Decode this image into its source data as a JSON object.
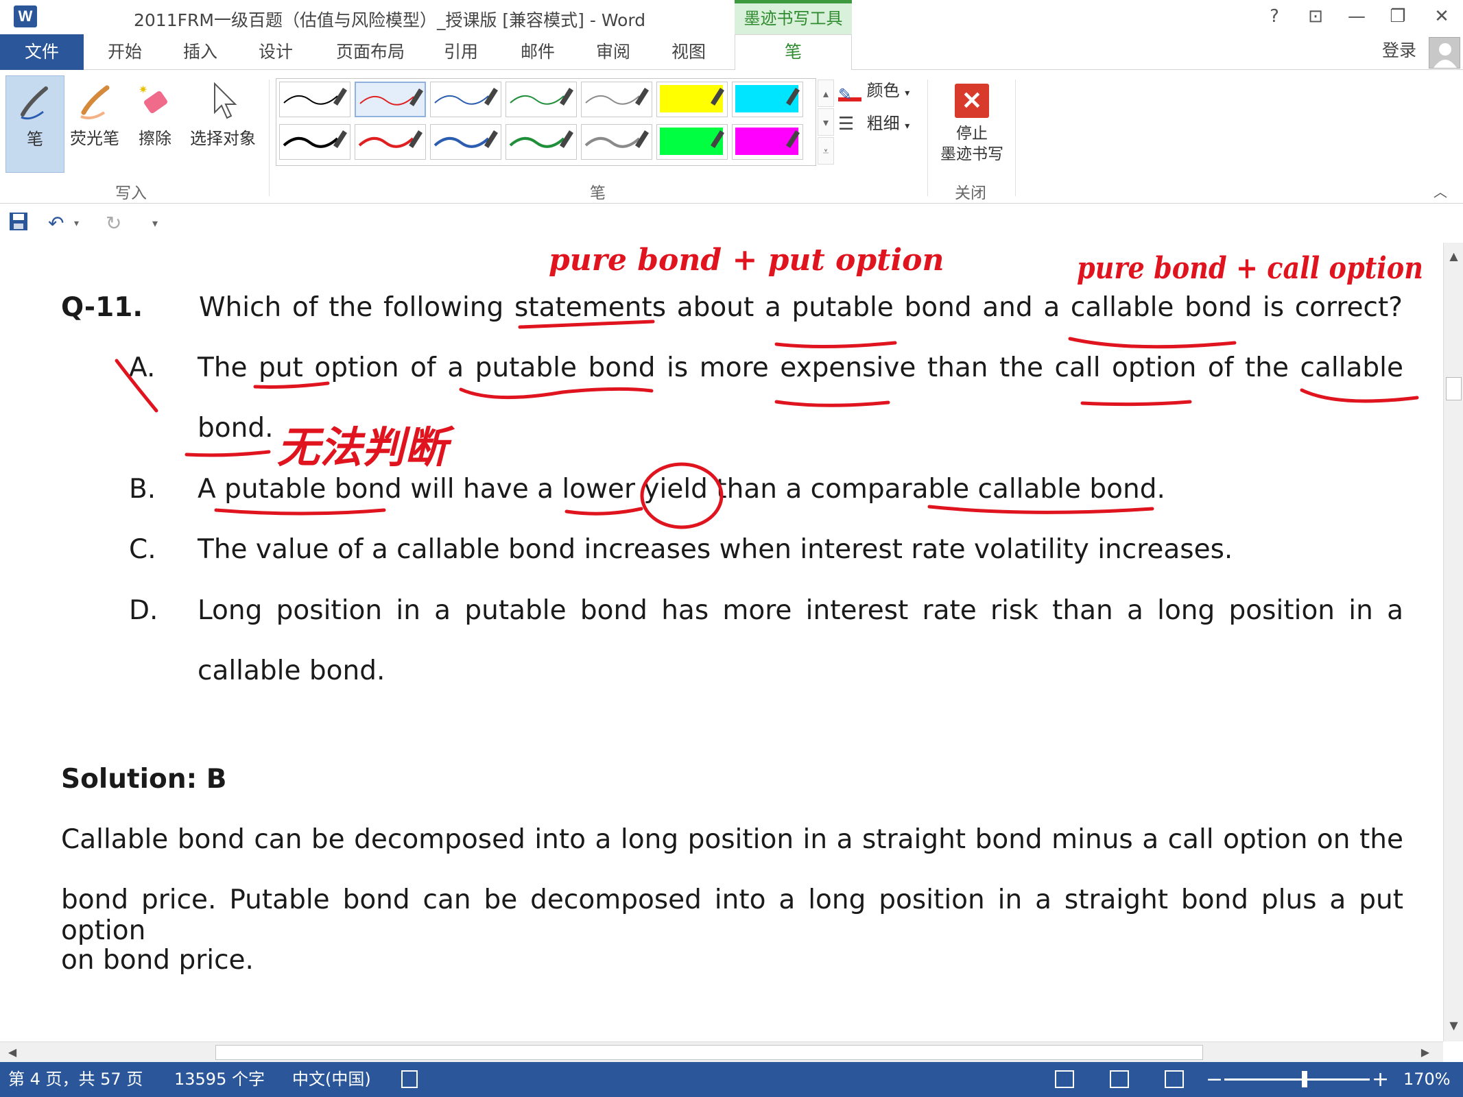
{
  "window": {
    "title": "2011FRM一级百题（估值与风险模型）_授课版 [兼容模式] - Word",
    "contextual_tab": "墨迹书写工具",
    "help": "?",
    "ribbon_display": "⊡",
    "minimize": "—",
    "restore": "❐",
    "close": "✕"
  },
  "tabs": {
    "file": "文件",
    "items": [
      "开始",
      "插入",
      "设计",
      "页面布局",
      "引用",
      "邮件",
      "审阅",
      "视图"
    ],
    "active": "笔",
    "login": "登录"
  },
  "ribbon": {
    "write_group": {
      "label": "写入",
      "pen": "笔",
      "highlighter": "荧光笔",
      "eraser": "擦除",
      "select": "选择对象"
    },
    "pens_group": {
      "label": "笔",
      "color": "颜色",
      "thickness": "粗细",
      "swatches_row1": [
        "#000000",
        "#e02020",
        "#2a5db0",
        "#1f8f3a",
        "#8a8a8a",
        "#ffff00",
        "#00e5ff"
      ],
      "swatches_row2": [
        "#000000",
        "#e02020",
        "#2a5db0",
        "#1f8f3a",
        "#8a8a8a",
        "#00ff40",
        "#ff00ff"
      ]
    },
    "close_group": {
      "label": "关闭",
      "stop_ink_line1": "停止",
      "stop_ink_line2": "墨迹书写"
    }
  },
  "qat": {
    "save": "💾",
    "undo": "↶",
    "redo": "↻",
    "customize": "▾"
  },
  "document": {
    "question_number": "Q-11.",
    "question_text": "Which of the following statements about a putable bond and a callable bond is correct?",
    "options": [
      {
        "letter": "A.",
        "line1": "The put option of a putable bond is more expensive than the call option of the callable",
        "line2": "bond."
      },
      {
        "letter": "B.",
        "line1": "A putable bond will have a lower yield than a comparable callable bond."
      },
      {
        "letter": "C.",
        "line1": "The value of a callable bond increases when interest rate volatility increases."
      },
      {
        "letter": "D.",
        "line1": "Long position in a putable bond has more interest rate risk than a long position in a",
        "line2": "callable bond."
      }
    ],
    "solution_heading": "Solution: B",
    "solution_lines": [
      "Callable bond can be decomposed into a long position in a straight bond minus a call option on the",
      "bond price. Putable bond can be decomposed into a long position in a straight bond plus a put option",
      "on bond price."
    ],
    "ink_notes": {
      "note1": "pure bond + put option",
      "note2": "pure bond + call option",
      "note3": "无法判断",
      "ink_color": "#e0141e"
    }
  },
  "status": {
    "page": "第 4 页，共 57 页",
    "words": "13595 个字",
    "language": "中文(中国)",
    "zoom_minus": "−",
    "zoom_plus": "+",
    "zoom": "170%",
    "zoom_fraction": 0.55
  }
}
